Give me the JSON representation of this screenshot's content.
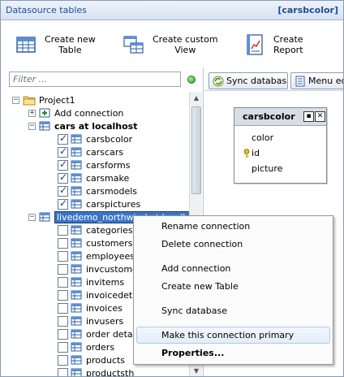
{
  "window": {
    "panel_title": "Datasource tables",
    "context_title": "[carsbcolor]"
  },
  "toolbar": {
    "create_table": "Create new\nTable",
    "create_view": "Create custom\nView",
    "create_report": "Create\nReport"
  },
  "filter": {
    "placeholder": "Filter ..."
  },
  "tree": {
    "project": "Project1",
    "add_connection": "Add connection",
    "connection1": {
      "label": "cars at localhost",
      "tables": [
        "carsbcolor",
        "carscars",
        "carsforms",
        "carsmake",
        "carsmodels",
        "carspictures"
      ]
    },
    "connection2": {
      "label": "livedemo_northwind at localhost",
      "tables": [
        "categories",
        "customers",
        "employees",
        "invcustomer",
        "invitems",
        "invoicedetail",
        "invoices",
        "invusers",
        "order details",
        "orders",
        "products",
        "productsth"
      ]
    }
  },
  "right_toolbar": {
    "sync": "Sync database",
    "menu": "Menu editor"
  },
  "entity": {
    "name": "carsbcolor",
    "fields": [
      "color",
      "id",
      "picture"
    ]
  },
  "context_menu": {
    "items": [
      "Rename connection",
      "Delete connection",
      "Add connection",
      "Create new Table",
      "Sync database",
      "Make this connection primary",
      "Properties..."
    ]
  },
  "colors": {
    "title_text": "#1f4e95",
    "selection": "#3a74c9",
    "status_led": "#17a317"
  }
}
